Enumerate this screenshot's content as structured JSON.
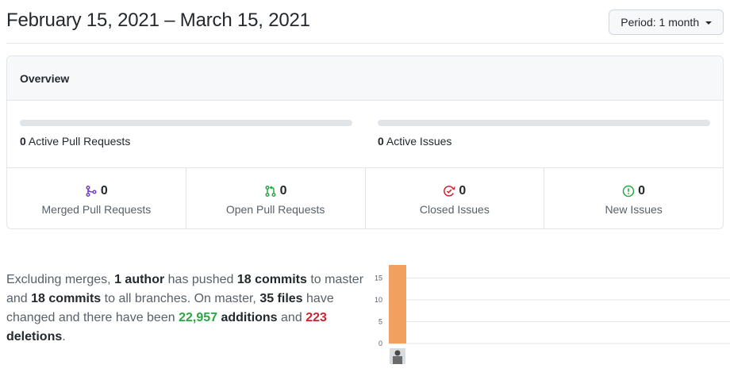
{
  "header": {
    "date_range": "February 15, 2021 – March 15, 2021",
    "period_label": "Period:",
    "period_value": "1 month"
  },
  "overview": {
    "title": "Overview",
    "pull_requests": {
      "count": "0",
      "label": "Active Pull Requests",
      "merged_fraction": 0
    },
    "issues": {
      "count": "0",
      "label": "Active Issues",
      "closed_fraction": 0
    },
    "stats": [
      {
        "icon": "merged-pr-icon",
        "count": "0",
        "label": "Merged Pull Requests",
        "color": "#6f42c1"
      },
      {
        "icon": "open-pr-icon",
        "count": "0",
        "label": "Open Pull Requests",
        "color": "#28a745"
      },
      {
        "icon": "closed-issue-icon",
        "count": "0",
        "label": "Closed Issues",
        "color": "#cb2431"
      },
      {
        "icon": "new-issue-icon",
        "count": "0",
        "label": "New Issues",
        "color": "#28a745"
      }
    ]
  },
  "commits_summary": {
    "t1": "Excluding merges,",
    "authors": "1 author",
    "t2": "has pushed",
    "commits_master": "18 commits",
    "t3": "to master and",
    "commits_all": "18 commits",
    "t4": "to all branches. On master,",
    "files": "35 files",
    "t5": "have changed and there have been",
    "additions_count": "22,957",
    "additions_word": "additions",
    "t6": "and",
    "deletions_count": "223",
    "deletions_word": "deletions",
    "t7": "."
  },
  "chart_data": {
    "type": "bar",
    "categories": [
      "author-1"
    ],
    "values": [
      18
    ],
    "ylim": [
      0,
      18
    ],
    "yticks": [
      "0",
      "5",
      "10",
      "15"
    ],
    "ytick_values": [
      0,
      5,
      10,
      15
    ],
    "bar_color": "#f1a060",
    "grid": true
  }
}
